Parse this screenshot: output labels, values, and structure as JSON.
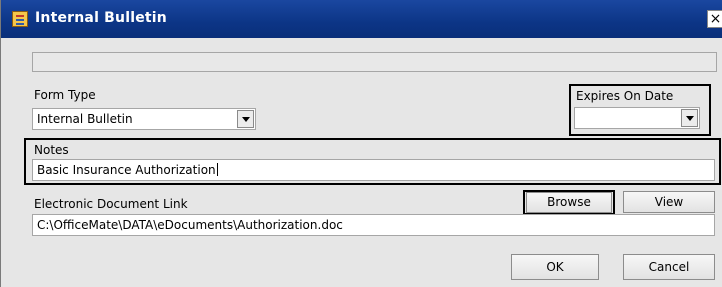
{
  "window": {
    "title": "Internal Bulletin",
    "close_glyph": "×",
    "icon": "bulletin-icon"
  },
  "form": {
    "form_type": {
      "label": "Form Type",
      "value": "Internal Bulletin"
    },
    "expires": {
      "label": "Expires On Date",
      "value": ""
    },
    "notes": {
      "label": "Notes",
      "value": "Basic Insurance Authorization"
    },
    "doc_link": {
      "label": "Electronic Document Link",
      "value": "C:\\OfficeMate\\DATA\\eDocuments\\Authorization.doc",
      "browse_label": "Browse",
      "view_label": "View"
    }
  },
  "buttons": {
    "ok_label": "OK",
    "cancel_label": "Cancel"
  },
  "colors": {
    "titlebar": "#0c3586",
    "dialog_bg": "#e6e6e6",
    "highlight_box": "#000000"
  }
}
